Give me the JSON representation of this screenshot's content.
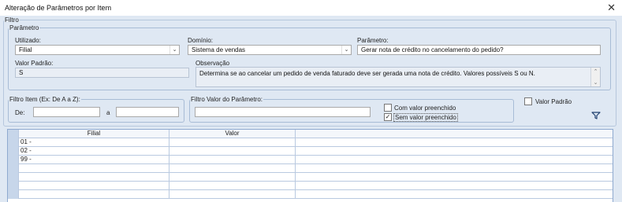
{
  "window": {
    "title": "Alteração de Parâmetros por Item",
    "close_glyph": "✕"
  },
  "filtro": {
    "legend": "Filtro",
    "parametro_group": {
      "legend": "Parâmetro",
      "utilizado": {
        "label": "Utilizado:",
        "value": "Filial"
      },
      "dominio": {
        "label": "Domínio:",
        "value": "Sistema de vendas"
      },
      "parametro": {
        "label": "Parâmetro:",
        "value": "Gerar nota de crédito no cancelamento do pedido?"
      },
      "valor_padrao": {
        "label": "Valor Padrão:",
        "value": "S"
      },
      "observacao": {
        "label": "Observação",
        "value": "Determina se ao cancelar um pedido de venda faturado deve ser gerada uma nota de crédito. Valores possíveis S ou N."
      }
    },
    "filtro_item": {
      "legend": "Filtro Item (Ex: De A a Z):",
      "de_label": "De:",
      "a_label": "a",
      "de_value": "",
      "a_value": ""
    },
    "filtro_valor": {
      "legend": "Filtro Valor do Parâmetro:",
      "value": "",
      "com_valor": {
        "label": "Com valor preenchido",
        "checked": false
      },
      "sem_valor": {
        "label": "Sem valor preenchido",
        "checked": true
      }
    },
    "valor_padrao_check": {
      "label": "Valor Padrão",
      "checked": false
    }
  },
  "grid": {
    "columns": [
      "Filial",
      "Valor"
    ],
    "rows": [
      {
        "filial": "01 -",
        "valor": ""
      },
      {
        "filial": "02 -",
        "valor": ""
      },
      {
        "filial": "99 -",
        "valor": ""
      },
      {
        "filial": "",
        "valor": ""
      },
      {
        "filial": "",
        "valor": ""
      },
      {
        "filial": "",
        "valor": ""
      },
      {
        "filial": "",
        "valor": ""
      }
    ]
  },
  "icons": {
    "close": "close-icon",
    "dropdown": "chevron-down-icon",
    "filter": "filter-icon",
    "check": "check-icon"
  },
  "colors": {
    "panel_bg": "#dfe8f3",
    "border": "#a8bcd6",
    "grid_border": "#b9c9e0",
    "row_header": "#c7d6ea"
  }
}
